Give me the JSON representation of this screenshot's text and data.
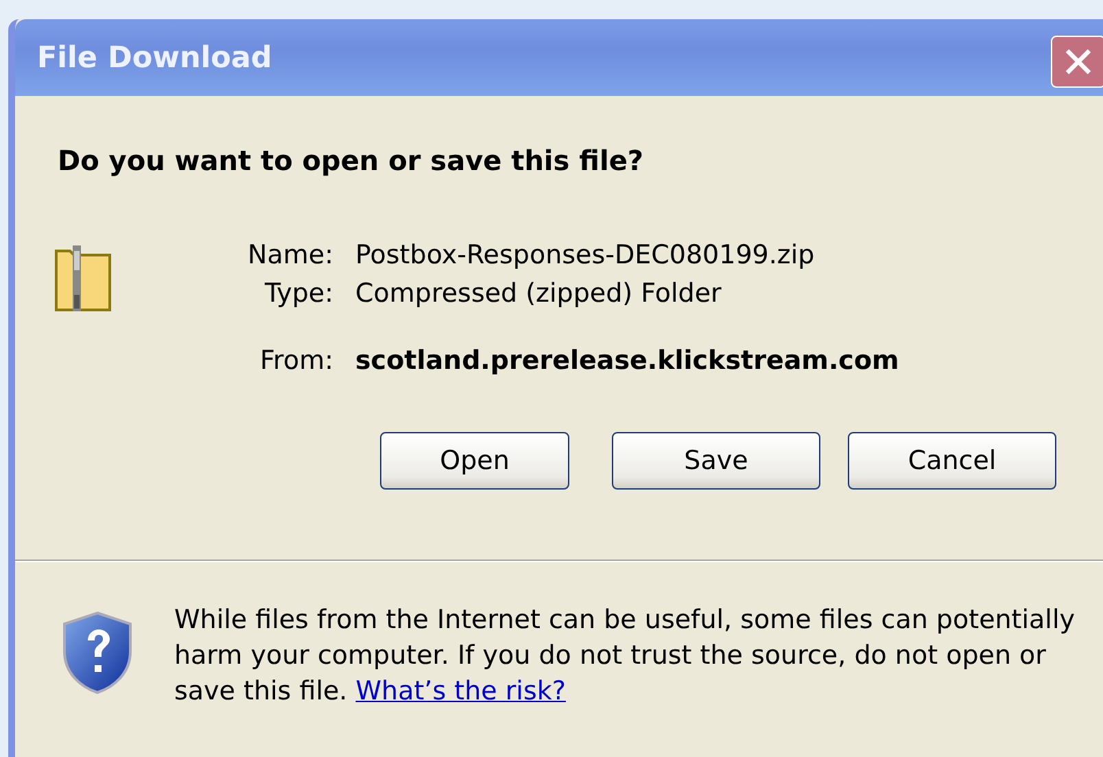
{
  "window": {
    "title": "File Download"
  },
  "question": "Do you want to open or save this file?",
  "details": [
    {
      "label": "Name:",
      "value": "Postbox-Responses-DEC080199.zip",
      "bold": false
    },
    {
      "label": "Type:",
      "value": "Compressed (zipped) Folder",
      "bold": false
    },
    {
      "label": "From:",
      "value": "scotland.prerelease.klickstream.com",
      "bold": true
    }
  ],
  "buttons": [
    "Open",
    "Save",
    "Cancel"
  ],
  "warning": {
    "text": "While files from the Internet can be useful, some files can potentially harm your computer. If you do not trust the source, do not open or save this file.",
    "link": "What’s the risk?"
  }
}
